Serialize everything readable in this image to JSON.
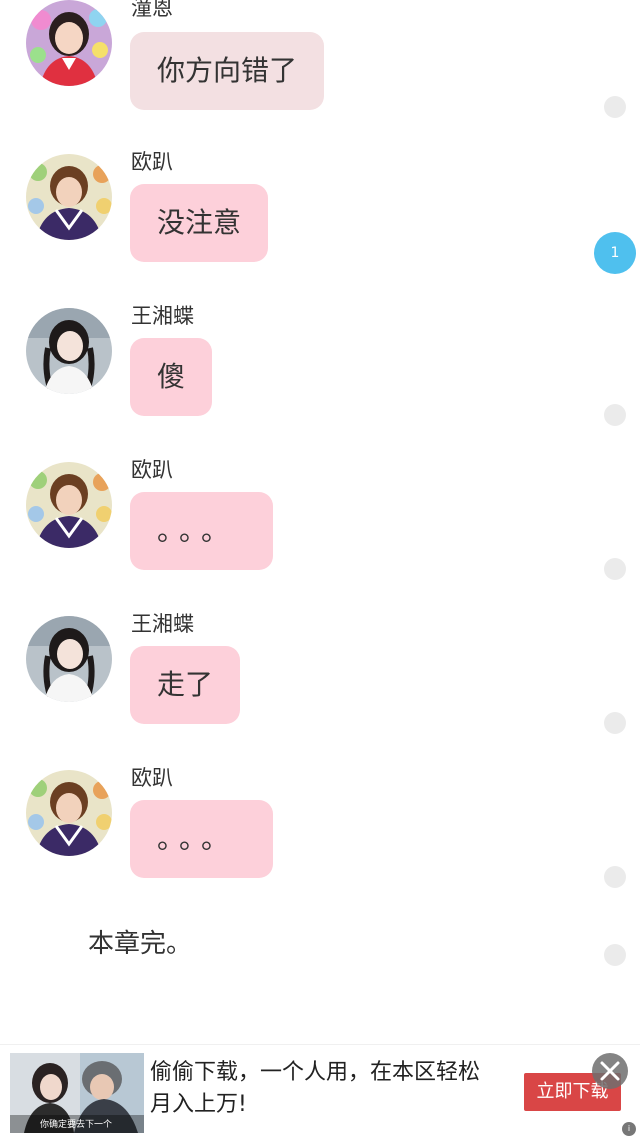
{
  "messages": [
    {
      "sender": "潼恩",
      "text": "你方向错了",
      "avatar": "female-avatar-red-icon"
    },
    {
      "sender": "欧趴",
      "text": "没注意",
      "avatar": "male-avatar-icon"
    },
    {
      "sender": "王湘蝶",
      "text": "傻",
      "avatar": "female-avatar-braids-icon"
    },
    {
      "sender": "欧趴",
      "text": "。。。",
      "avatar": "male-avatar-icon"
    },
    {
      "sender": "王湘蝶",
      "text": "走了",
      "avatar": "female-avatar-braids-icon"
    },
    {
      "sender": "欧趴",
      "text": "。。。",
      "avatar": "male-avatar-icon"
    }
  ],
  "comment_badge": "1",
  "chapter_end": "本章完。",
  "ad": {
    "headline": "偷偷下载，一个人用，在本区轻松月入上万!",
    "button": "立即下载",
    "image_caption": "你确定要去下一个"
  },
  "colors": {
    "bubble": "#fdd0da",
    "bubble_muted": "#f3e0e2",
    "badge": "#4fc0ee",
    "ad_button": "#d94646"
  }
}
